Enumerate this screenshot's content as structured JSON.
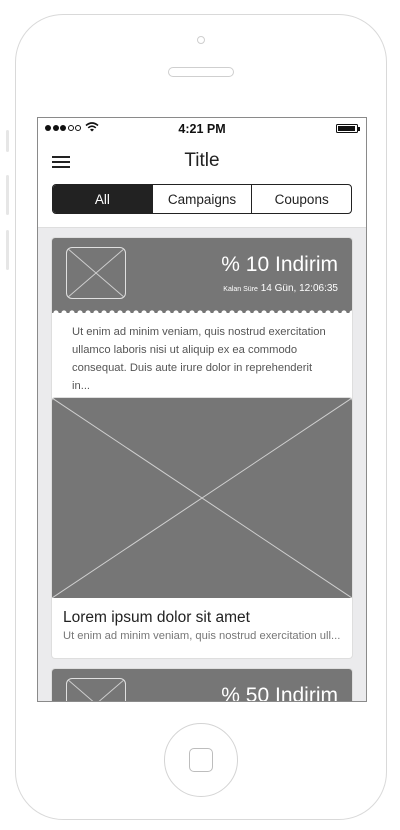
{
  "status_bar": {
    "time": "4:21 PM",
    "signal_bars": 5,
    "signal_filled": 3
  },
  "nav": {
    "title": "Title"
  },
  "segments": {
    "items": [
      "All",
      "Campaigns",
      "Coupons"
    ],
    "selected": "All"
  },
  "cards": [
    {
      "type": "coupon",
      "discount": "% 10 Indirim",
      "remaining_label": "Kalan Süre",
      "remaining_value": "14 Gün, 12:06:35",
      "description": "Ut enim ad minim veniam, quis nostrud exercitation ullamco laboris nisi ut aliquip ex ea commodo consequat. Duis aute irure dolor in reprehenderit in..."
    },
    {
      "type": "campaign",
      "title": "Lorem ipsum dolor sit amet",
      "description": "Ut enim ad minim veniam, quis nostrud exercitation ull..."
    },
    {
      "type": "coupon",
      "discount": "% 50 Indirim"
    }
  ],
  "colors": {
    "placeholder_gray": "#767676",
    "background": "#ebebed",
    "active_segment": "#222222"
  }
}
